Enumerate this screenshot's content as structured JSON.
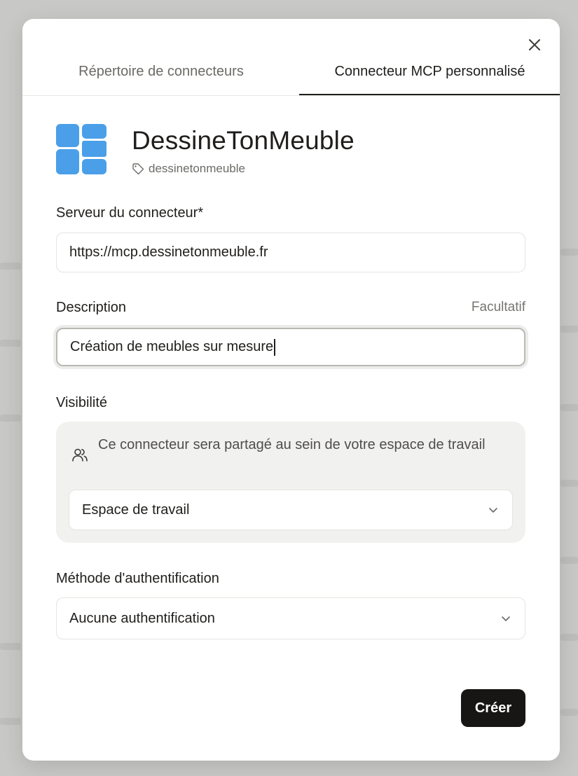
{
  "tabs": [
    {
      "label": "Répertoire de connecteurs",
      "active": false
    },
    {
      "label": "Connecteur MCP personnalisé",
      "active": true
    }
  ],
  "close_icon": "close-icon",
  "connector": {
    "name": "DessineTonMeuble",
    "tag": "dessinetonmeuble",
    "logo_color": "#4a9fe8"
  },
  "server": {
    "label": "Serveur du connecteur*",
    "value": "https://mcp.dessinetonmeuble.fr"
  },
  "description": {
    "label": "Description",
    "optional_label": "Facultatif",
    "value": "Création de meubles sur mesure"
  },
  "visibility": {
    "label": "Visibilité",
    "info": "Ce connecteur sera partagé au sein de votre espace de travail",
    "selected": "Espace de travail"
  },
  "auth": {
    "label": "Méthode d'authentification",
    "selected": "Aucune authentification"
  },
  "create_label": "Créer"
}
